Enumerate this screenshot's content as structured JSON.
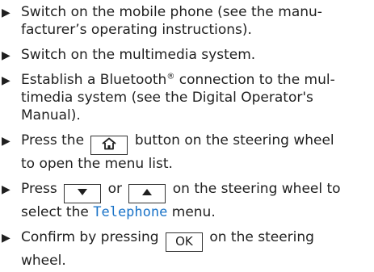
{
  "steps": [
    {
      "lines": [
        "Switch on the mobile phone (see the manu-",
        "facturer’s operating instructions)."
      ]
    },
    {
      "lines": [
        "Switch on the multimedia system."
      ]
    },
    {
      "pre": "Establish a Bluetooth",
      "reg": "®",
      "post": " connection to the mul-",
      "lines": [
        "timedia system (see the Digital Operator's",
        "Manual)."
      ]
    },
    {
      "a": "Press the",
      "key_icon": "home-icon",
      "b": "button on the steering wheel",
      "lines": [
        "to open the menu list."
      ]
    },
    {
      "a": "Press",
      "key1_icon": "down-arrow-icon",
      "or": "or",
      "key2_icon": "up-arrow-icon",
      "b": "on the steering wheel to",
      "c": "select the",
      "menu": "Telephone",
      "d": "menu."
    },
    {
      "a": "Confirm by pressing",
      "key_label": "OK",
      "b": "on the steering",
      "lines": [
        "wheel."
      ]
    }
  ],
  "bullet_glyph": "▶",
  "colors": {
    "text": "#1f1f1f",
    "display_text": "#1a73c8"
  }
}
